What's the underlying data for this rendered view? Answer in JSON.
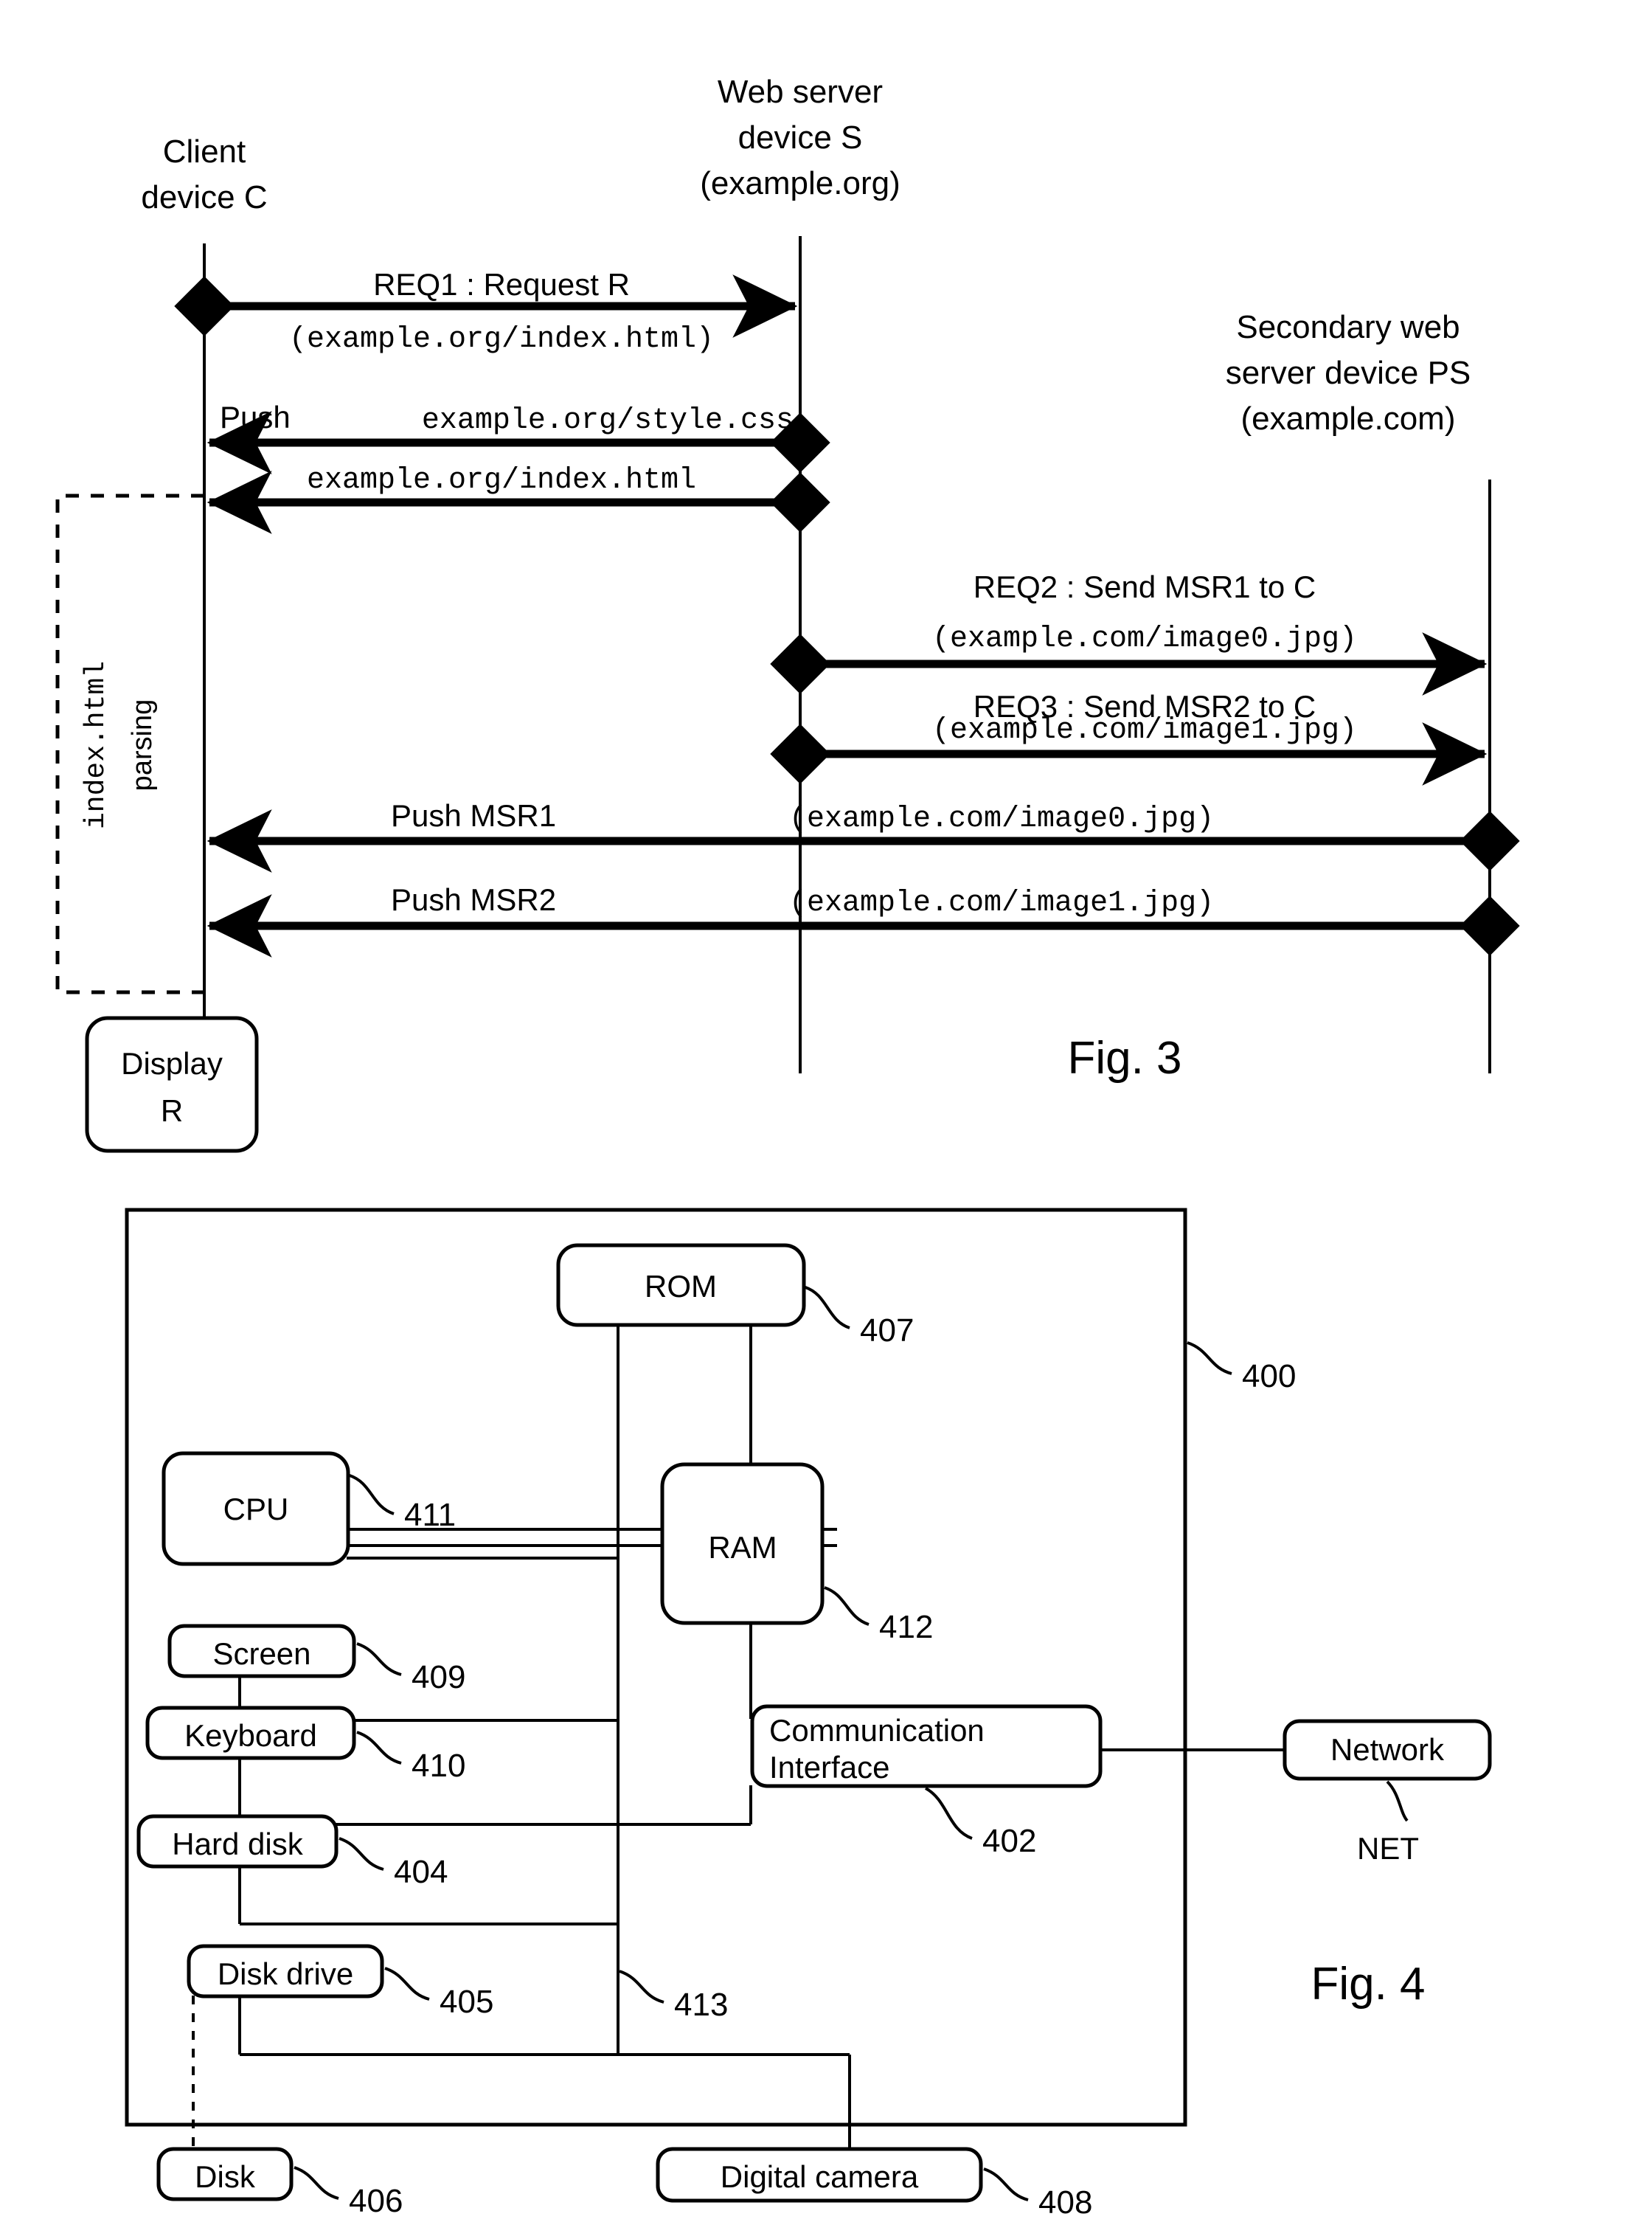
{
  "figure3": {
    "caption": "Fig. 3",
    "actors": [
      {
        "id": "client",
        "lines": [
          "Client",
          "device C"
        ]
      },
      {
        "id": "webserver",
        "lines": [
          "Web server",
          "device S",
          "(example.org)"
        ]
      },
      {
        "id": "secondary",
        "lines": [
          "Secondary web",
          "server device PS",
          "(example.com)"
        ]
      }
    ],
    "messages": [
      {
        "id": "req1",
        "label": "REQ1 : Request R",
        "detail": "(example.org/index.html)",
        "from": "client",
        "to": "webserver",
        "direction": "right"
      },
      {
        "id": "push_css",
        "label": "Push ",
        "detail": "example.org/style.css",
        "from": "webserver",
        "to": "client",
        "direction": "left"
      },
      {
        "id": "push_html",
        "label": "",
        "detail": "example.org/index.html",
        "from": "webserver",
        "to": "client",
        "direction": "left"
      },
      {
        "id": "req2",
        "label": "REQ2 : Send MSR1 to C",
        "detail": "(example.com/image0.jpg)",
        "from": "webserver",
        "to": "secondary",
        "direction": "right"
      },
      {
        "id": "req3",
        "label": "REQ3 : Send MSR2 to C",
        "detail": "(example.com/image1.jpg)",
        "from": "webserver",
        "to": "secondary",
        "direction": "right"
      },
      {
        "id": "msr1",
        "label": "Push MSR1 ",
        "detail": "(example.com/image0.jpg)",
        "from": "secondary",
        "to": "client",
        "direction": "left"
      },
      {
        "id": "msr2",
        "label": "Push MSR2 ",
        "detail": "(example.com/image1.jpg)",
        "from": "secondary",
        "to": "client",
        "direction": "left"
      }
    ],
    "parsing_block": {
      "mono_text": "index.html",
      "sans_text": "parsing"
    },
    "display_box": {
      "line1": "Display",
      "line2": "R"
    }
  },
  "figure4": {
    "caption": "Fig. 4",
    "blocks": [
      {
        "id": "rom",
        "label": "ROM",
        "ref": "407"
      },
      {
        "id": "cpu",
        "label": "CPU",
        "ref": "411"
      },
      {
        "id": "ram",
        "label": "RAM",
        "ref": "412"
      },
      {
        "id": "screen",
        "label": "Screen",
        "ref": "409"
      },
      {
        "id": "keyboard",
        "label": "Keyboard",
        "ref": "410"
      },
      {
        "id": "harddisk",
        "label": "Hard disk",
        "ref": "404"
      },
      {
        "id": "diskdrive",
        "label": "Disk drive",
        "ref": "405"
      },
      {
        "id": "disk",
        "label": "Disk",
        "ref": "406"
      },
      {
        "id": "comm1",
        "label": "Communication",
        "label2": "Interface",
        "ref": "402"
      },
      {
        "id": "network",
        "label": "Network",
        "ref": "NET"
      },
      {
        "id": "camera",
        "label": "Digital camera",
        "ref": "408"
      }
    ],
    "device_ref": "400",
    "bus_ref": "413"
  }
}
